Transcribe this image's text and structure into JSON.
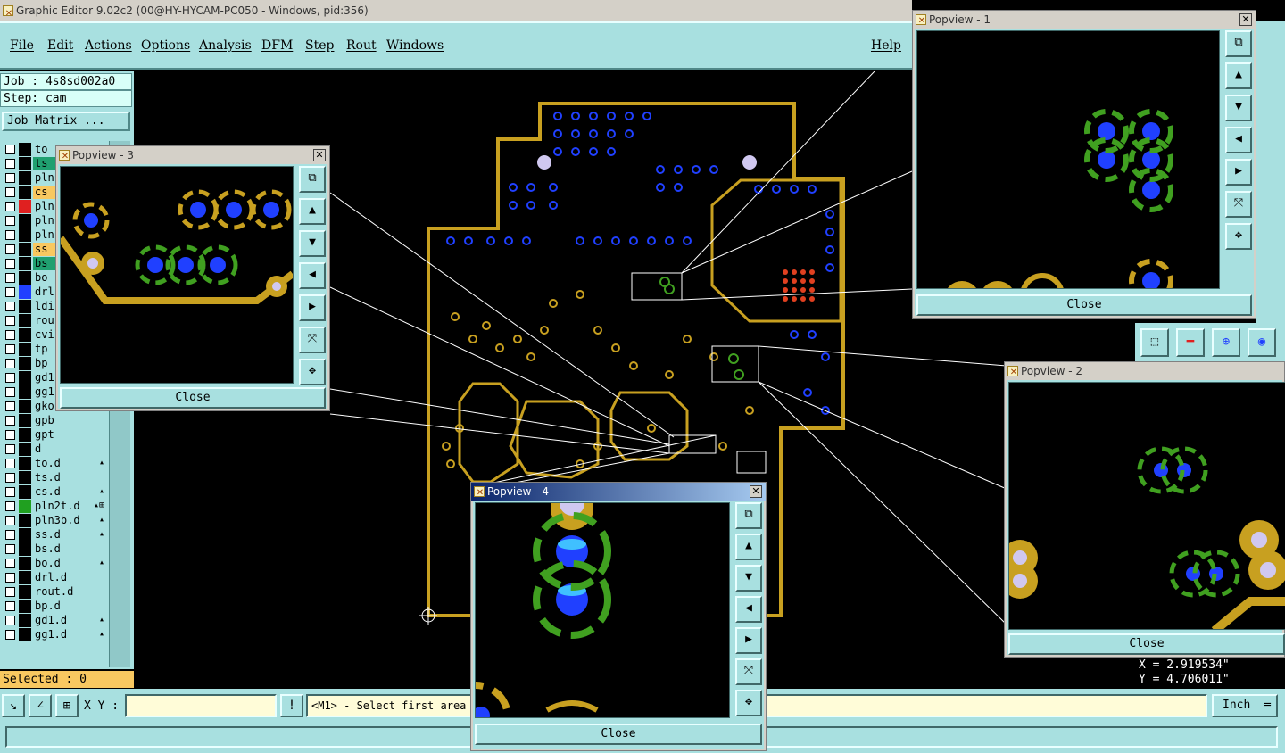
{
  "window": {
    "title": "Graphic Editor 9.02c2 (00@HY-HYCAM-PC050 - Windows, pid:356)"
  },
  "menu": {
    "items": [
      "File",
      "Edit",
      "Actions",
      "Options",
      "Analysis",
      "DFM",
      "Step",
      "Rout",
      "Windows"
    ],
    "help": "Help"
  },
  "job": {
    "job_line": "Job : 4s8sd002a0",
    "step_line": "Step: cam",
    "matrix_button": "Job Matrix ..."
  },
  "layers": [
    {
      "name": "to",
      "color": "#000000",
      "mark": ""
    },
    {
      "name": "ts",
      "color": "#000000",
      "mark": "",
      "highlight": "#20a070"
    },
    {
      "name": "pln",
      "color": "#000000",
      "mark": ""
    },
    {
      "name": "cs",
      "color": "#000000",
      "mark": "",
      "highlight": "#f8c860"
    },
    {
      "name": "pln",
      "color": "#e02020",
      "mark": ""
    },
    {
      "name": "pln",
      "color": "#000000",
      "mark": ""
    },
    {
      "name": "pln",
      "color": "#000000",
      "mark": ""
    },
    {
      "name": "ss",
      "color": "#000000",
      "mark": "",
      "highlight": "#f8c860"
    },
    {
      "name": "bs",
      "color": "#000000",
      "mark": "",
      "highlight": "#20a070"
    },
    {
      "name": "bo",
      "color": "#000000",
      "mark": ""
    },
    {
      "name": "drl",
      "color": "#2040ff",
      "mark": ""
    },
    {
      "name": "ldi",
      "color": "#000000",
      "mark": ""
    },
    {
      "name": "rou",
      "color": "#000000",
      "mark": ""
    },
    {
      "name": "cvi",
      "color": "#000000",
      "mark": ""
    },
    {
      "name": "tp",
      "color": "#000000",
      "mark": ""
    },
    {
      "name": "bp",
      "color": "#000000",
      "mark": ""
    },
    {
      "name": "gd1",
      "color": "#000000",
      "mark": ""
    },
    {
      "name": "gg1",
      "color": "#000000",
      "mark": "▴"
    },
    {
      "name": "gko",
      "color": "#000000",
      "mark": "▴"
    },
    {
      "name": "gpb",
      "color": "#000000",
      "mark": ""
    },
    {
      "name": "gpt",
      "color": "#000000",
      "mark": ""
    },
    {
      "name": "d",
      "color": "#000000",
      "mark": ""
    },
    {
      "name": "to.d",
      "color": "#000000",
      "mark": "▴"
    },
    {
      "name": "ts.d",
      "color": "#000000",
      "mark": ""
    },
    {
      "name": "cs.d",
      "color": "#000000",
      "mark": "▴"
    },
    {
      "name": "pln2t.d",
      "color": "#20a020",
      "mark": "▴⊞"
    },
    {
      "name": "pln3b.d",
      "color": "#000000",
      "mark": "▴"
    },
    {
      "name": "ss.d",
      "color": "#000000",
      "mark": "▴"
    },
    {
      "name": "bs.d",
      "color": "#000000",
      "mark": ""
    },
    {
      "name": "bo.d",
      "color": "#000000",
      "mark": "▴"
    },
    {
      "name": "drl.d",
      "color": "#000000",
      "mark": ""
    },
    {
      "name": "rout.d",
      "color": "#000000",
      "mark": ""
    },
    {
      "name": "bp.d",
      "color": "#000000",
      "mark": ""
    },
    {
      "name": "gd1.d",
      "color": "#000000",
      "mark": "▴"
    },
    {
      "name": "gg1.d",
      "color": "#000000",
      "mark": "▴"
    }
  ],
  "selected": {
    "label": "Selected : 0"
  },
  "xy": {
    "label": "X Y :",
    "value": ""
  },
  "message": {
    "text": "<M1> - Select first area"
  },
  "units": {
    "label": "Inch"
  },
  "coords": {
    "x": "X = 2.919534\"",
    "y": "Y = 4.706011\""
  },
  "popviews": {
    "p1": {
      "title": "Popview - 1",
      "close": "Close"
    },
    "p2": {
      "title": "Popview - 2",
      "close": "Close"
    },
    "p3": {
      "title": "Popview - 3",
      "close": "Close"
    },
    "p4": {
      "title": "Popview - 4",
      "close": "Close"
    }
  },
  "colors": {
    "panel": "#a8e0e0",
    "copper": "#c8a020",
    "drill": "#2040ff",
    "green": "#40a020"
  }
}
